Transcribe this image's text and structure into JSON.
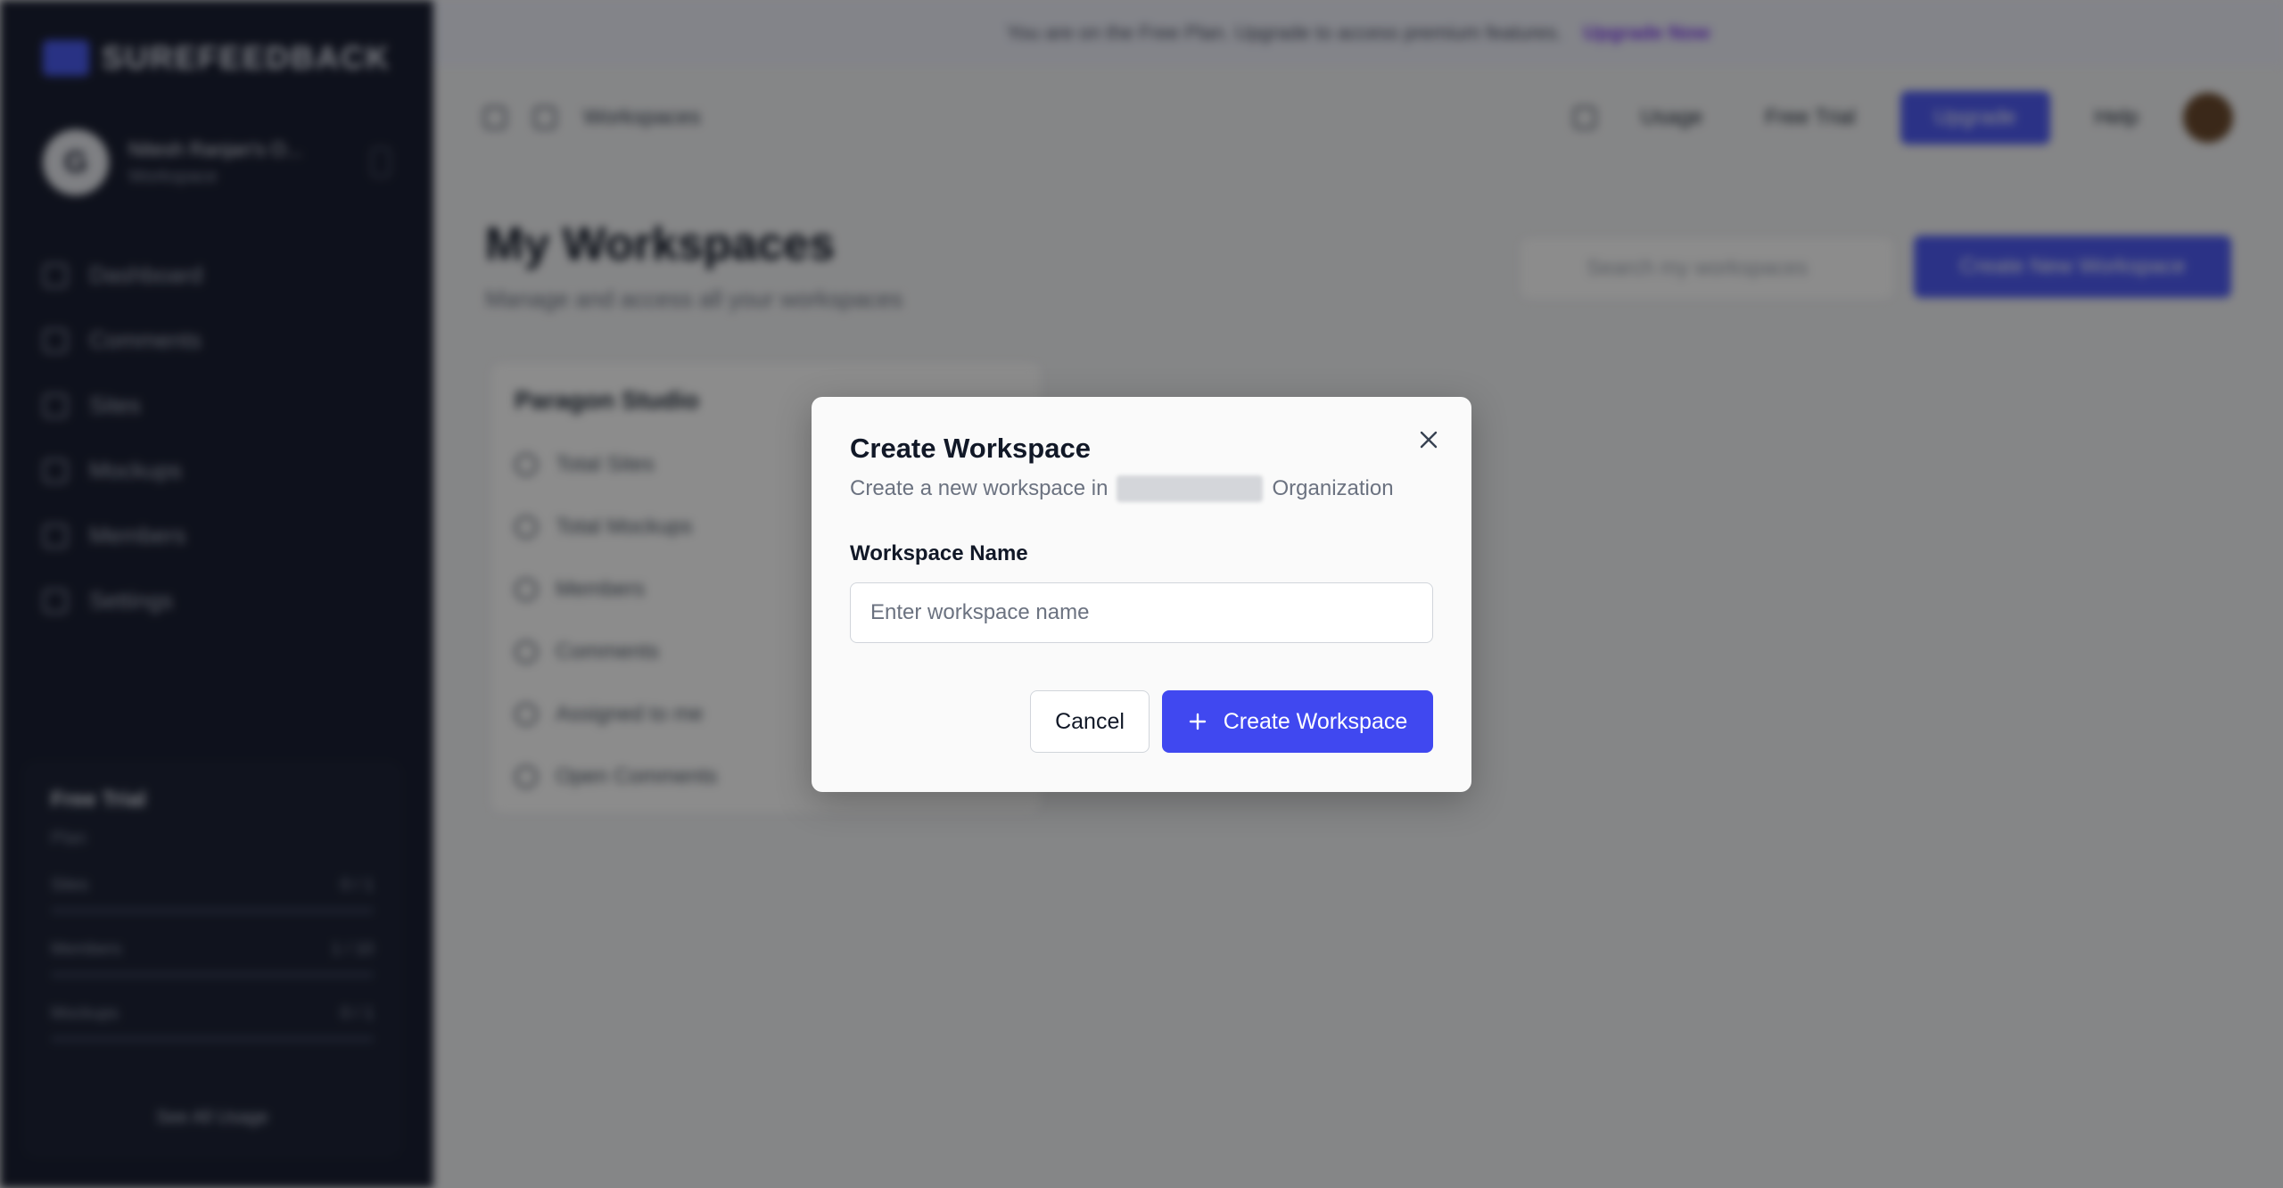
{
  "background": {
    "brand": "SUREFEEDBACK",
    "workspace": {
      "initial": "G",
      "name": "Nitesh Ranjan's O...",
      "type": "Workspace"
    },
    "nav": [
      "Dashboard",
      "Comments",
      "Sites",
      "Mockups",
      "Members",
      "Settings"
    ],
    "plan": {
      "title": "Free Trial",
      "subtitle": "Plan",
      "usage": [
        {
          "label": "Sites",
          "value": "0 / 1"
        },
        {
          "label": "Members",
          "value": "1 / 10"
        },
        {
          "label": "Mockups",
          "value": "0 / 1"
        }
      ],
      "see_all": "See All Usage"
    },
    "banner": {
      "text": "You are on the Free Plan. Upgrade to access premium features.",
      "link": "Upgrade Now"
    },
    "topbar": {
      "breadcrumb": "Workspaces",
      "usage": "Usage",
      "free_trial": "Free Trial",
      "upgrade": "Upgrade",
      "help": "Help"
    },
    "page": {
      "title": "My Workspaces",
      "subtitle": "Manage and access all your workspaces",
      "search_placeholder": "Search my workspaces",
      "create_new": "Create New Workspace"
    },
    "project_card": {
      "title": "Paragon Studio",
      "stats": [
        "Total Sites",
        "Total Mockups",
        "Members",
        "Comments",
        "Assigned to me",
        "Open Comments"
      ]
    }
  },
  "modal": {
    "title": "Create Workspace",
    "description_prefix": "Create a new workspace in",
    "description_suffix": "Organization",
    "field_label": "Workspace Name",
    "field_placeholder": "Enter workspace name",
    "field_value": "",
    "cancel_label": "Cancel",
    "create_label": "Create Workspace"
  },
  "colors": {
    "primary": "#4048f0",
    "sidebar": "#1b2033"
  }
}
